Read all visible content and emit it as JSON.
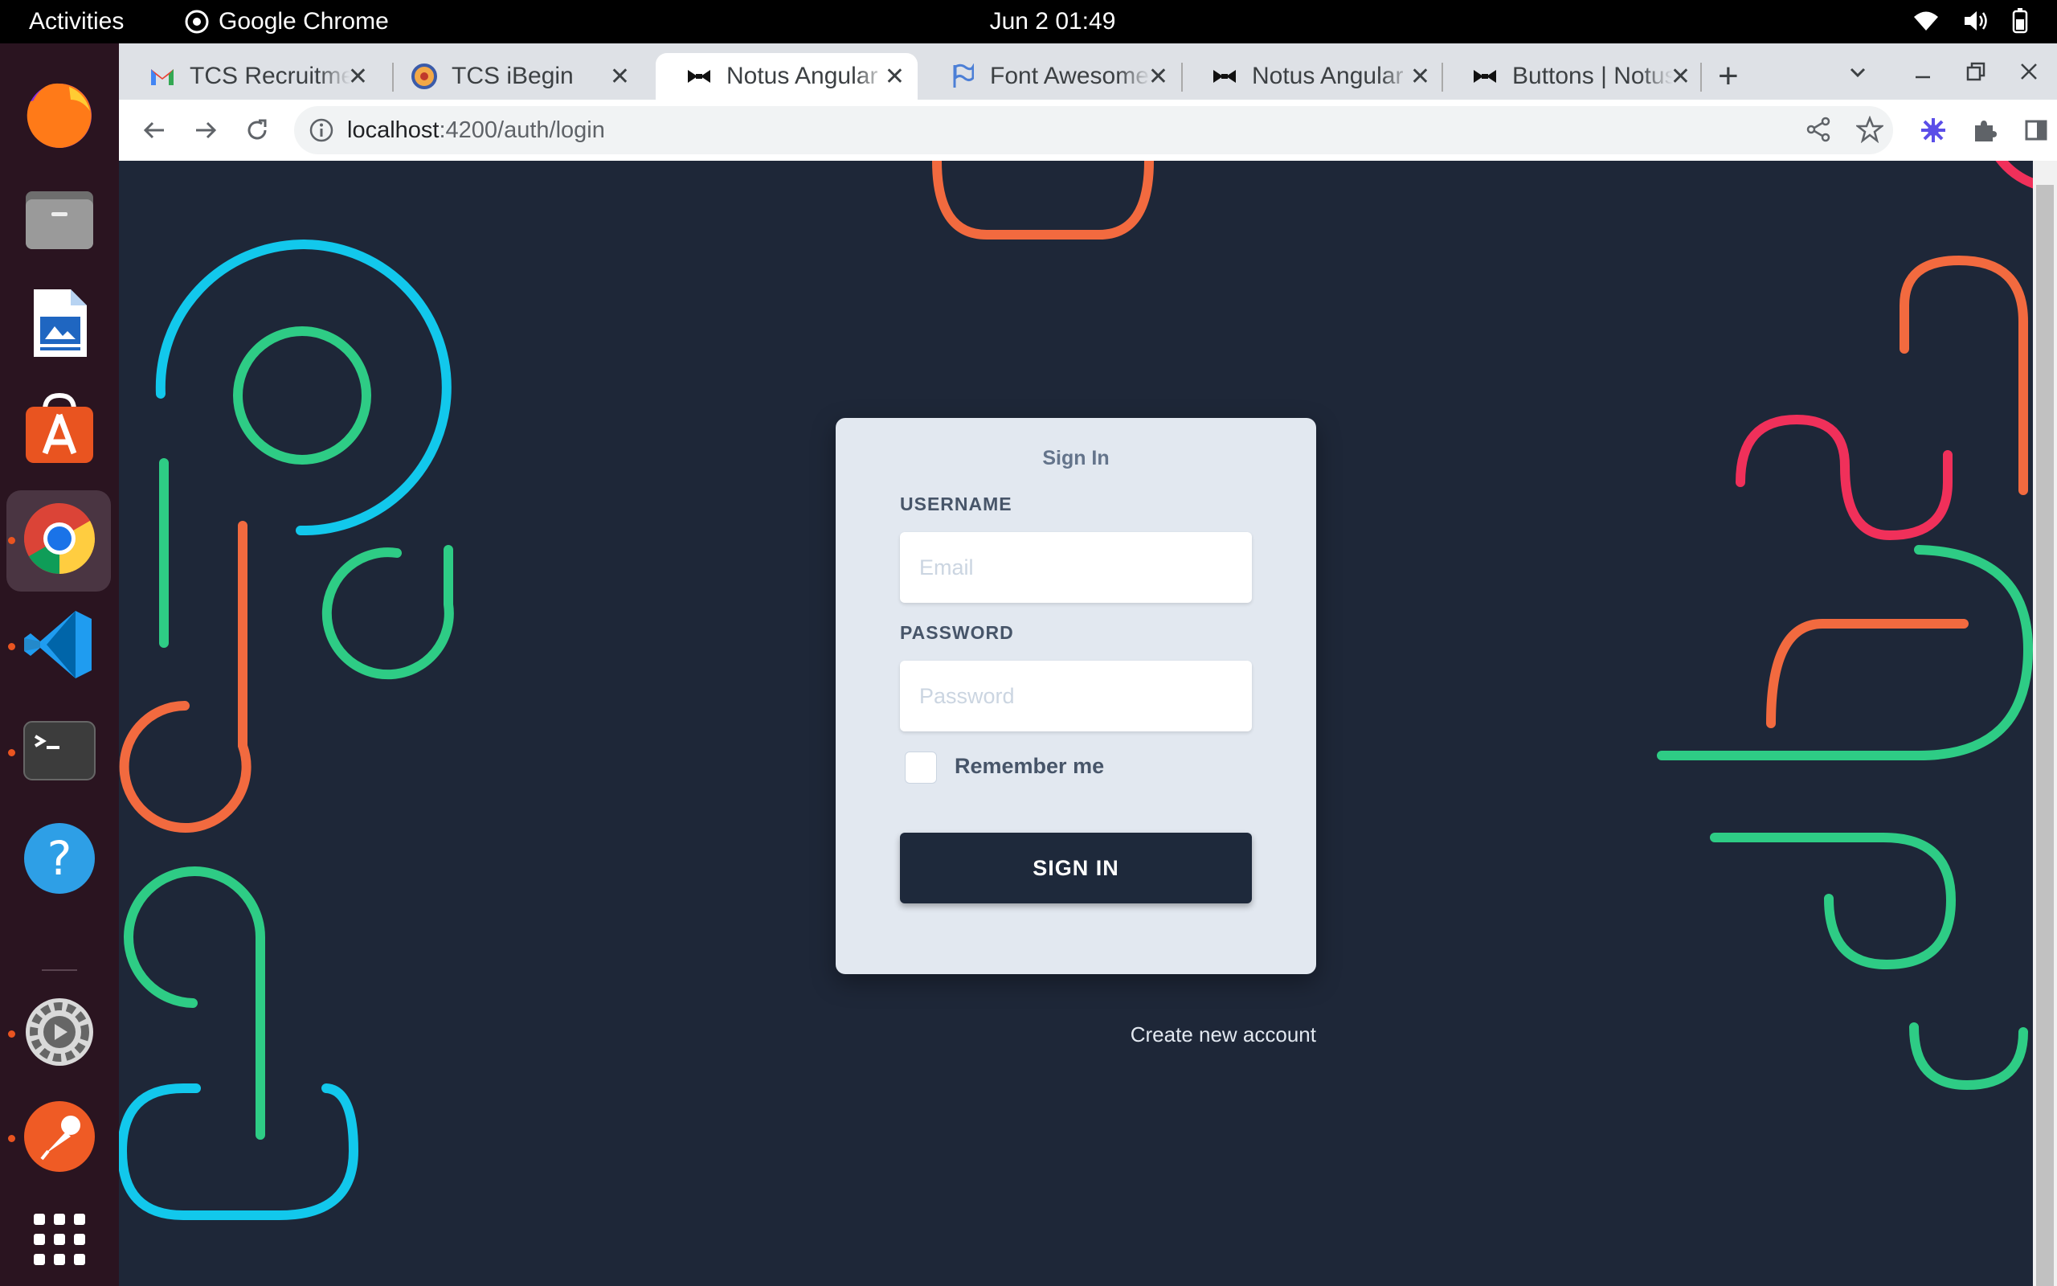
{
  "system": {
    "activities": "Activities",
    "app_name": "Google Chrome",
    "clock": "Jun 2  01:49"
  },
  "dock": {
    "items": [
      "firefox",
      "files",
      "libreoffice-writer",
      "app-center",
      "chrome",
      "vscode",
      "terminal",
      "help",
      "settings",
      "postman",
      "show-apps"
    ]
  },
  "browser": {
    "tabs": [
      {
        "title": "TCS Recruitment",
        "icon": "gmail-icon"
      },
      {
        "title": "TCS iBegin",
        "icon": "tcs-icon"
      },
      {
        "title": "Notus Angular",
        "icon": "notus-icon",
        "active": true
      },
      {
        "title": "Font Awesome",
        "icon": "flag-icon"
      },
      {
        "title": "Notus Angular",
        "icon": "notus-icon"
      },
      {
        "title": "Buttons | Notus",
        "icon": "notus-icon"
      }
    ],
    "url_host": "localhost",
    "url_path": ":4200/auth/login"
  },
  "login": {
    "heading": "Sign In",
    "username_label": "USERNAME",
    "username_placeholder": "Email",
    "password_label": "PASSWORD",
    "password_placeholder": "Password",
    "remember_label": "Remember me",
    "signin_label": "SIGN IN",
    "create_account": "Create new account"
  },
  "colors": {
    "background": "#1e2738",
    "card": "#e2e8f0",
    "button": "#1e293b",
    "orange": "#f26a3f",
    "green": "#2ecc85",
    "cyan": "#12c8ec",
    "pink": "#f0305a"
  }
}
